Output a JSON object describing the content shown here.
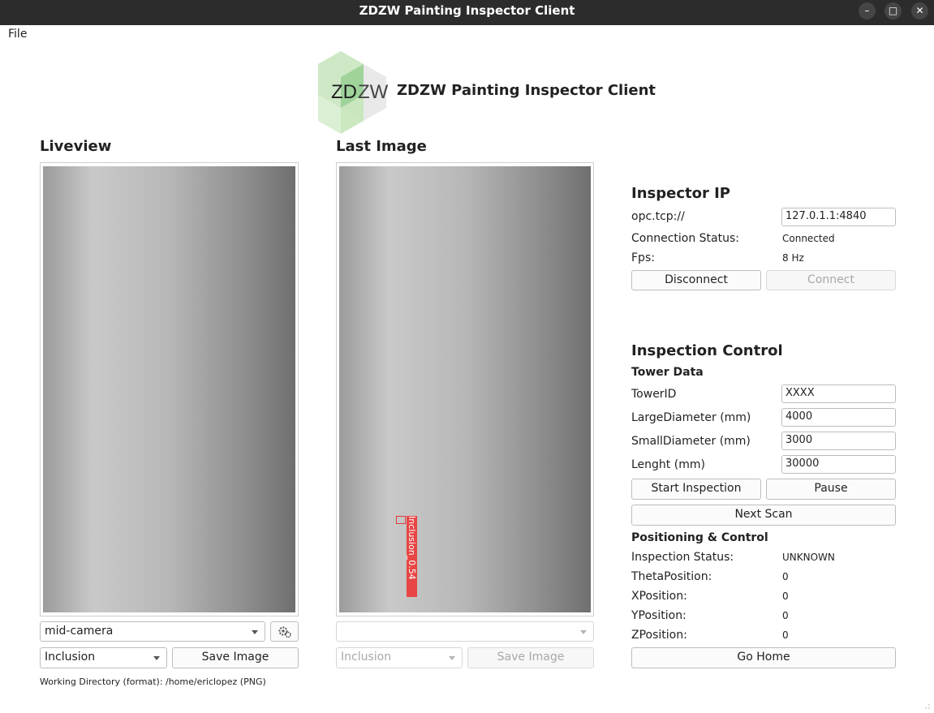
{
  "window": {
    "title": "ZDZW Painting Inspector Client"
  },
  "menu": {
    "file": "File"
  },
  "header": {
    "logo_text_zd": "ZD",
    "logo_text_zw": "ZW",
    "app_title": "ZDZW Painting Inspector Client"
  },
  "liveview": {
    "title": "Liveview",
    "camera_select": "mid-camera",
    "type_select": "Inclusion",
    "save_button": "Save Image",
    "working_dir_label": "Working Directory (format):",
    "working_dir_value": "/home/ericlopez (PNG)"
  },
  "last_image": {
    "title": "Last Image",
    "camera_select": "",
    "type_select": "Inclusion",
    "save_button": "Save Image",
    "detection_label": "Inclusion_0.54"
  },
  "inspector_ip": {
    "title": "Inspector IP",
    "prefix": "opc.tcp://",
    "address": "127.0.1.1:4840",
    "status_label": "Connection Status:",
    "status_value": "Connected",
    "fps_label": "Fps:",
    "fps_value": "8 Hz",
    "disconnect_button": "Disconnect",
    "connect_button": "Connect"
  },
  "inspection_control": {
    "title": "Inspection Control",
    "tower_data_title": "Tower Data",
    "tower_id_label": "TowerID",
    "tower_id_value": "XXXX",
    "large_diameter_label": "LargeDiameter (mm)",
    "large_diameter_value": "4000",
    "small_diameter_label": "SmallDiameter (mm)",
    "small_diameter_value": "3000",
    "length_label": "Lenght (mm)",
    "length_value": "30000",
    "start_button": "Start Inspection",
    "pause_button": "Pause",
    "next_scan_button": "Next Scan",
    "positioning_title": "Positioning & Control",
    "inspection_status_label": "Inspection Status:",
    "inspection_status_value": "UNKNOWN",
    "theta_label": "ThetaPosition:",
    "theta_value": "0",
    "x_label": "XPosition:",
    "x_value": "0",
    "y_label": "YPosition:",
    "y_value": "0",
    "z_label": "ZPosition:",
    "z_value": "0",
    "go_home_button": "Go Home"
  },
  "colors": {
    "titlebar": "#2c2c2c",
    "detection": "#e84545",
    "logo_green": "#b6e0a6"
  }
}
